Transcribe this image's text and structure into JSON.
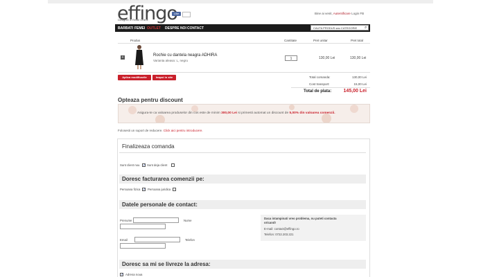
{
  "header": {
    "logo": "effingo",
    "tagline": "Designer & Retail Online",
    "fb_like": "Like",
    "fb_count": "",
    "welcome_text": "Bine ai venit,",
    "login_link": "Autentificare",
    "login_fb": "Login FB"
  },
  "nav": {
    "items": [
      "BARBATI",
      "FEMEI",
      "OUTLET",
      "DESPRE NOI",
      "CONTACT"
    ],
    "search_placeholder": "CAUTA PRODUS sau CATEGORIE"
  },
  "cart": {
    "columns": [
      "Produs",
      "Cantitate",
      "Pret unitar",
      "Pret total"
    ],
    "item": {
      "name": "Rochie cu dantela neagra ADHIRA",
      "variant": "Varianta aleasa: L, negru",
      "quantity": "1",
      "unit_price": "130,00 Lei",
      "total_price": "130,00 Lei"
    },
    "apply_button": "Aplica modificarile",
    "back_button": "Inapoi in site",
    "totals": {
      "order_label": "Total comanda:",
      "order_value": "130,00 Lei",
      "shipping_label": "Cost transport:",
      "shipping_value": "15,00 Lei",
      "pay_label": "Total de plata:",
      "pay_value": "145,00 Lei"
    }
  },
  "discount": {
    "title": "Opteaza pentru discount",
    "text_a": "Asigura-te ca valoarea produselor din cos este de minim ",
    "amount": "300,00 Lei",
    "text_b": " si primesti automat un discount de ",
    "percent": "5,00% din valoarea comenzii.",
    "voucher_text": "Folosesti un suport de reducere. ",
    "voucher_link": "Click aici pentru introducere."
  },
  "checkout": {
    "title": "Finalizeaza comanda",
    "new_client": "Sunt client nou",
    "existing_client": "Sunt deja client",
    "billing_title": "Doresc facturarea comenzii pe:",
    "person_fizica": "Persoana fizica",
    "person_juridica": "Persoana juridica",
    "personal_title": "Datele personale de contact:",
    "labels": {
      "prenume": "Prenume",
      "nume": "Nume",
      "email": "Email",
      "telefon": "Telefon"
    },
    "help": {
      "heading": "Daca intampinati vreo problema, nu puteti contacta oricand!",
      "email": "E-mail:  contact@effingo.ro",
      "phone": "Telefon:  0722.203.221"
    },
    "delivery_title": "Doresc sa mi se livreze la adresa:",
    "same_address": "Adresa noua"
  },
  "colors": {
    "accent": "#c9202b",
    "navbar": "#1b1b1b"
  }
}
